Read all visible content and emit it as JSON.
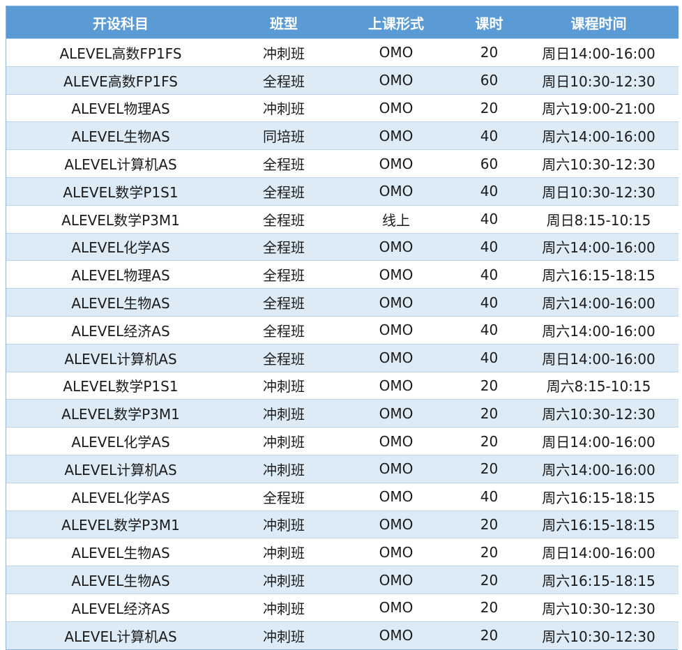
{
  "table": {
    "headers": [
      "开设科目",
      "班型",
      "上课形式",
      "课时",
      "课程时间"
    ],
    "rows": [
      [
        "ALEVEL高数FP1FS",
        "冲刺班",
        "OMO",
        "20",
        "周日14:00-16:00"
      ],
      [
        "ALEVE高数FP1FS",
        "全程班",
        "OMO",
        "60",
        "周日10:30-12:30"
      ],
      [
        "ALEVEL物理AS",
        "冲刺班",
        "OMO",
        "20",
        "周六19:00-21:00"
      ],
      [
        "ALEVEL生物AS",
        "同培班",
        "OMO",
        "40",
        "周六14:00-16:00"
      ],
      [
        "ALEVEL计算机AS",
        "全程班",
        "OMO",
        "60",
        "周六10:30-12:30"
      ],
      [
        "ALEVEL数学P1S1",
        "全程班",
        "OMO",
        "40",
        "周日10:30-12:30"
      ],
      [
        "ALEVEL数学P3M1",
        "全程班",
        "线上",
        "40",
        "周日8:15-10:15"
      ],
      [
        "ALEVEL化学AS",
        "全程班",
        "OMO",
        "40",
        "周六14:00-16:00"
      ],
      [
        "ALEVEL物理AS",
        "全程班",
        "OMO",
        "40",
        "周六16:15-18:15"
      ],
      [
        "ALEVEL生物AS",
        "全程班",
        "OMO",
        "40",
        "周六14:00-16:00"
      ],
      [
        "ALEVEL经济AS",
        "全程班",
        "OMO",
        "40",
        "周六14:00-16:00"
      ],
      [
        "ALEVEL计算机AS",
        "全程班",
        "OMO",
        "40",
        "周日14:00-16:00"
      ],
      [
        "ALEVEL数学P1S1",
        "冲刺班",
        "OMO",
        "20",
        "周六8:15-10:15"
      ],
      [
        "ALEVEL数学P3M1",
        "冲刺班",
        "OMO",
        "20",
        "周六10:30-12:30"
      ],
      [
        "ALEVEL化学AS",
        "冲刺班",
        "OMO",
        "20",
        "周日14:00-16:00"
      ],
      [
        "ALEVEL计算机AS",
        "冲刺班",
        "OMO",
        "20",
        "周六14:00-16:00"
      ],
      [
        "ALEVEL化学AS",
        "全程班",
        "OMO",
        "40",
        "周六16:15-18:15"
      ],
      [
        "ALEVEL数学P3M1",
        "冲刺班",
        "OMO",
        "20",
        "周六16:15-18:15"
      ],
      [
        "ALEVEL生物AS",
        "冲刺班",
        "OMO",
        "20",
        "周日14:00-16:00"
      ],
      [
        "ALEVEL生物AS",
        "冲刺班",
        "OMO",
        "20",
        "周六16:15-18:15"
      ],
      [
        "ALEVEL经济AS",
        "冲刺班",
        "OMO",
        "20",
        "周六10:30-12:30"
      ],
      [
        "ALEVEL计算机AS",
        "冲刺班",
        "OMO",
        "20",
        "周六10:30-12:30"
      ]
    ]
  },
  "colors": {
    "header_bg": "#5b9bd5",
    "stripe_bg": "#ddebf7"
  }
}
